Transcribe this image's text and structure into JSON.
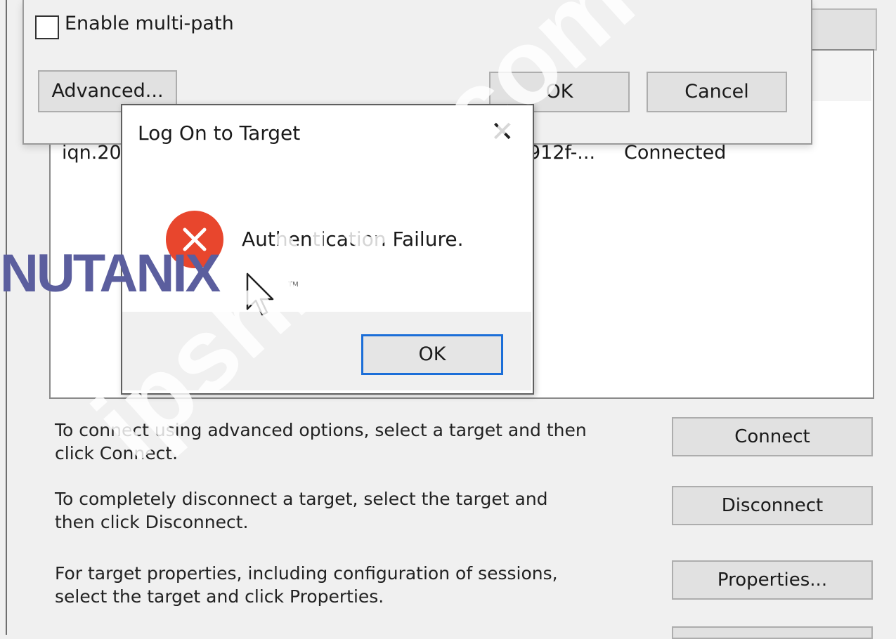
{
  "main": {
    "targets_row": {
      "name_part": "iqn.20",
      "id_part": "912f-...",
      "status": "Connected"
    },
    "instructions": [
      {
        "text_line1": "To connect using advanced options, select a target and then",
        "text_line2": "click Connect.",
        "button": "Connect"
      },
      {
        "text_line1": "To completely disconnect a target, select the target and",
        "text_line2": "then click Disconnect.",
        "button": "Disconnect"
      },
      {
        "text_line1": "For target properties, including configuration of sessions,",
        "text_line2": "select the target and click Properties.",
        "button": "Properties..."
      }
    ]
  },
  "advanced_window": {
    "multipath_label": "Enable multi-path",
    "multipath_checked": false,
    "advanced_button": "Advanced...",
    "ok_button": "OK",
    "cancel_button": "Cancel"
  },
  "dialog": {
    "title": "Log On to Target",
    "close_glyph": "✕",
    "message": "Authentication Failure.",
    "ok_button": "OK",
    "icon": "error-icon",
    "icon_color": "#e8462d"
  },
  "overlays": {
    "logo_text": "NUTANIX",
    "logo_tm": "TM",
    "watermark": "ipshikon.com"
  }
}
